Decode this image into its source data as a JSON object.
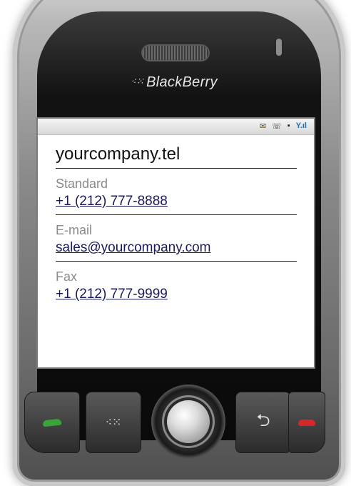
{
  "device": {
    "brand": "BlackBerry",
    "brand_logo_glyph": "⁖⁙",
    "status_icons": [
      "mail-icon",
      "call-log-icon",
      "lock-icon",
      "signal-icon"
    ]
  },
  "contact": {
    "company": "yourcompany.tel",
    "entries": [
      {
        "label": "Standard",
        "value": "+1 (212) 777-8888"
      },
      {
        "label": "E-mail",
        "value": "sales@yourcompany.com"
      },
      {
        "label": "Fax",
        "value": "+1 (212) 777-9999"
      }
    ]
  },
  "colors": {
    "accent_line": "#5b3aa0",
    "link_text": "#1a1a5a",
    "label_text": "#8a8a8a",
    "call_key": "#3aa33a",
    "end_key": "#d62828"
  }
}
